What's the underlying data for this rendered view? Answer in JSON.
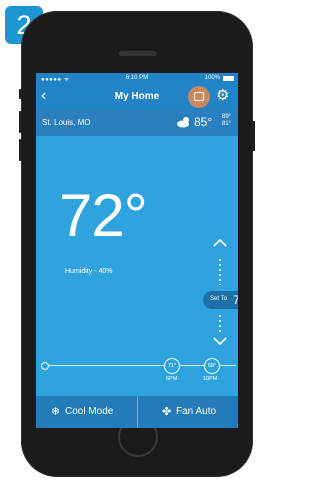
{
  "step_number": "2",
  "status_bar": {
    "signal": "●●●●● ᯤ",
    "time": "6:10 PM",
    "battery": "100%"
  },
  "nav": {
    "back_icon": "chevron-left-icon",
    "title": "My Home",
    "calendar_icon": "calendar-icon",
    "settings_icon": "gear-icon"
  },
  "location": {
    "name": "St. Louis, MO",
    "weather_icon": "partly-cloudy-icon",
    "temp": "85°",
    "high": "89°",
    "low": "81°"
  },
  "thermostat": {
    "current_temp": "72°",
    "humidity": "Humidity - 40%",
    "set_to_label": "Set To",
    "set_to_value": "71"
  },
  "schedule": [
    {
      "temp": "71°",
      "time": "6PM"
    },
    {
      "temp": "68°",
      "time": "10PM"
    }
  ],
  "bottom": {
    "cool_mode": "Cool Mode",
    "fan_auto": "Fan Auto"
  },
  "colors": {
    "screen": "#2fa3dd",
    "header": "#2283c6",
    "badge": "#1f96d3",
    "calendar": "#c98a5e"
  }
}
